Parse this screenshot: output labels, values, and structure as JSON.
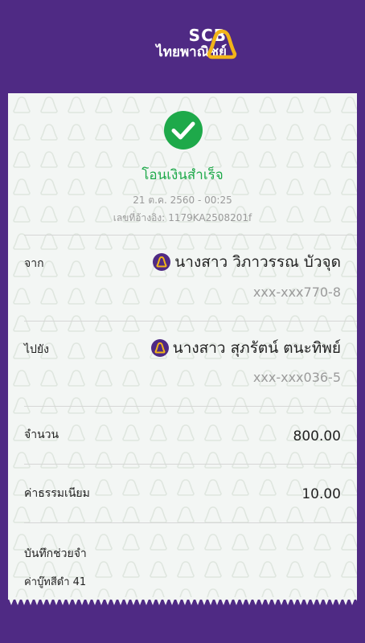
{
  "header": {
    "brand_en": "SCB",
    "brand_th": "ไทยพาณิชย์",
    "brand_color": "#4f2a84",
    "logo_icon": "scb-bell-logo",
    "logo_color": "#f2b418"
  },
  "receipt": {
    "status_icon": "check-circle-icon",
    "status_color": "#1ea94a",
    "status_text": "โอนเงินสำเร็จ",
    "datetime": "21 ต.ค. 2560 - 00:25",
    "reference_label": "เลขที่อ้างอิง:",
    "reference_value": "1179KA2508201f",
    "from": {
      "label": "จาก",
      "name": "นางสาว วิภาวรรณ บัวจุด",
      "account": "xxx-xxx770-8"
    },
    "to": {
      "label": "ไปยัง",
      "name": "นางสาว สุภรัตน์ ตนะทิพย์",
      "account": "xxx-xxx036-5"
    },
    "amount": {
      "label": "จำนวน",
      "value": "800.00"
    },
    "fee": {
      "label": "ค่าธรรมเนียม",
      "value": "10.00"
    },
    "memo": {
      "label": "บันทึกช่วยจำ",
      "text": "ค่าบู๊ทสีดำ 41"
    }
  }
}
